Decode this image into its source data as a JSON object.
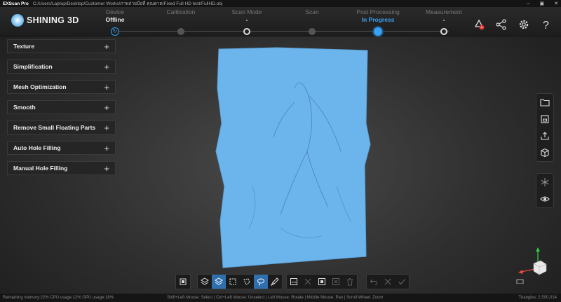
{
  "titlebar": {
    "app_name": "EXScan Pro",
    "path": "C:/Users/Laptop/Desktop/Customer Works/ภาพถ่ายมือที่ คุณดาด/Fixed Full HD test/FullHD.obj"
  },
  "logo": {
    "text": "SHINING 3D"
  },
  "steps": [
    {
      "label": "Device",
      "value": "Offline"
    },
    {
      "label": "Calibration",
      "value": ""
    },
    {
      "label": "Scan Mode",
      "value": "-"
    },
    {
      "label": "Scan",
      "value": ""
    },
    {
      "label": "Post Processing",
      "value": "In Progress"
    },
    {
      "label": "Measurement",
      "value": "-"
    }
  ],
  "panel": {
    "items": [
      {
        "label": "Texture"
      },
      {
        "label": "Simplification"
      },
      {
        "label": "Mesh Optimization"
      },
      {
        "label": "Smooth"
      },
      {
        "label": "Remove Small Floating Parts"
      },
      {
        "label": "Auto Hole Filling"
      },
      {
        "label": "Manual Hole Filling"
      }
    ],
    "plus": "+"
  },
  "status": {
    "left": "Remaining memory:22% CPU usage:12% GPU usage:18%",
    "middle": "Shift+Left Mouse: Select | Ctrl+Left Mouse: Unselect | Left Mouse: Rotate | Middle Mouse: Pan | Scroll Wheel: Zoom",
    "right": "Triangles: 2,500,014"
  },
  "colors": {
    "accent": "#3aa0f0",
    "mesh": "#6cb4ec"
  }
}
